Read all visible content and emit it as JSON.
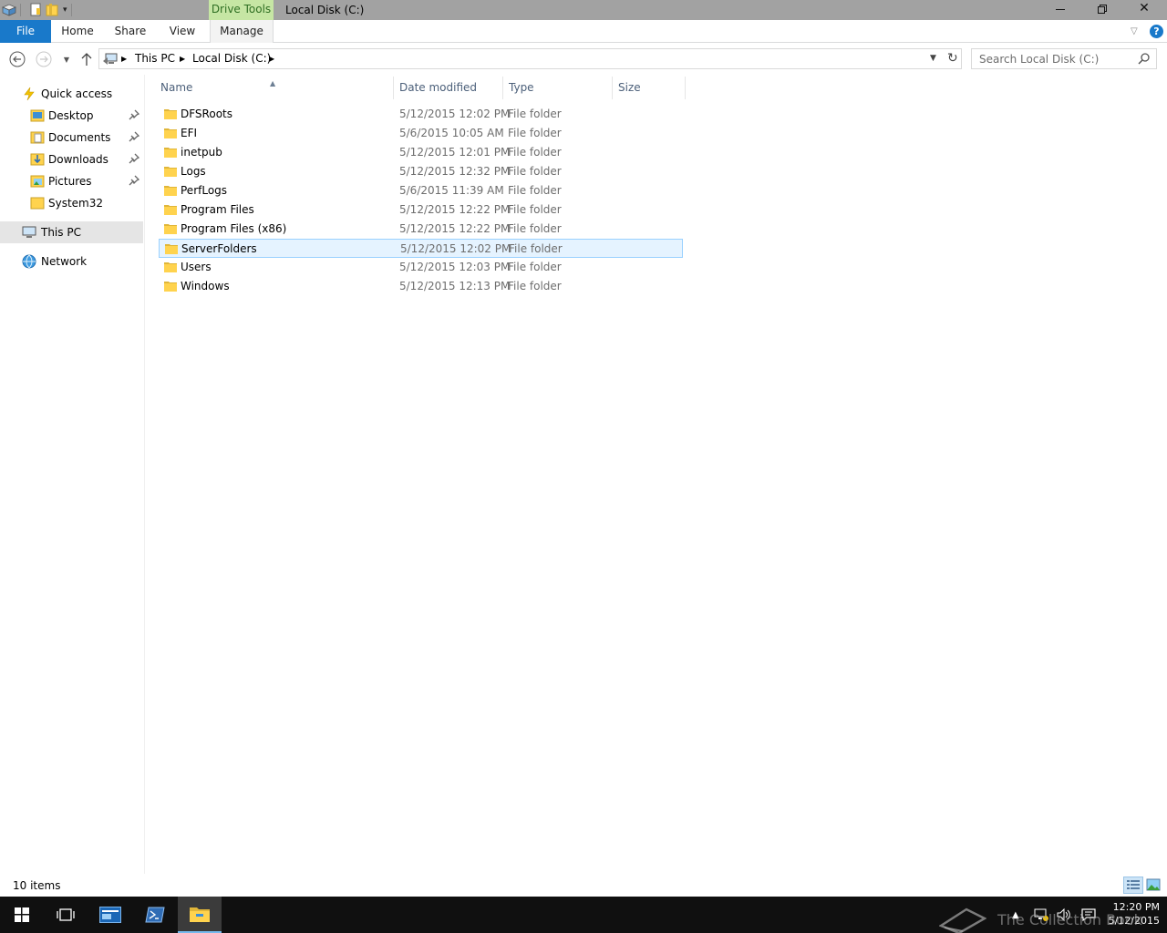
{
  "titlebar": {
    "context_tab": "Drive Tools",
    "title": "Local Disk (C:)"
  },
  "ribbon": {
    "tabs": [
      "File",
      "Home",
      "Share",
      "View",
      "Manage"
    ]
  },
  "address": {
    "crumbs": [
      "This PC",
      "Local Disk (C:)"
    ]
  },
  "search": {
    "placeholder": "Search Local Disk (C:)"
  },
  "navpane": {
    "quick_access": "Quick access",
    "pinned": [
      "Desktop",
      "Documents",
      "Downloads",
      "Pictures"
    ],
    "recent": "System32",
    "this_pc": "This PC",
    "network": "Network"
  },
  "columns": {
    "name": "Name",
    "date": "Date modified",
    "type": "Type",
    "size": "Size"
  },
  "files": [
    {
      "name": "DFSRoots",
      "date": "5/12/2015 12:02 PM",
      "type": "File folder",
      "size": ""
    },
    {
      "name": "EFI",
      "date": "5/6/2015 10:05 AM",
      "type": "File folder",
      "size": ""
    },
    {
      "name": "inetpub",
      "date": "5/12/2015 12:01 PM",
      "type": "File folder",
      "size": ""
    },
    {
      "name": "Logs",
      "date": "5/12/2015 12:32 PM",
      "type": "File folder",
      "size": ""
    },
    {
      "name": "PerfLogs",
      "date": "5/6/2015 11:39 AM",
      "type": "File folder",
      "size": ""
    },
    {
      "name": "Program Files",
      "date": "5/12/2015 12:22 PM",
      "type": "File folder",
      "size": ""
    },
    {
      "name": "Program Files (x86)",
      "date": "5/12/2015 12:22 PM",
      "type": "File folder",
      "size": ""
    },
    {
      "name": "ServerFolders",
      "date": "5/12/2015 12:02 PM",
      "type": "File folder",
      "size": "",
      "selected": true
    },
    {
      "name": "Users",
      "date": "5/12/2015 12:03 PM",
      "type": "File folder",
      "size": ""
    },
    {
      "name": "Windows",
      "date": "5/12/2015 12:13 PM",
      "type": "File folder",
      "size": ""
    }
  ],
  "status": {
    "item_count": "10 items"
  },
  "taskbar": {
    "time": "12:20 PM",
    "date": "5/12/2015",
    "watermark": "The Collection Book"
  },
  "icons": {
    "folder": "folder-icon",
    "pin": "pin-icon",
    "quick_access": "star-icon",
    "this_pc": "computer-icon",
    "network": "network-icon"
  },
  "colors": {
    "file_tab": "#1979ca",
    "drive_tools": "#c6e6a4",
    "selection_bg": "#e5f3ff",
    "selection_border": "#99d1ff",
    "folder": "#ffd34e"
  }
}
